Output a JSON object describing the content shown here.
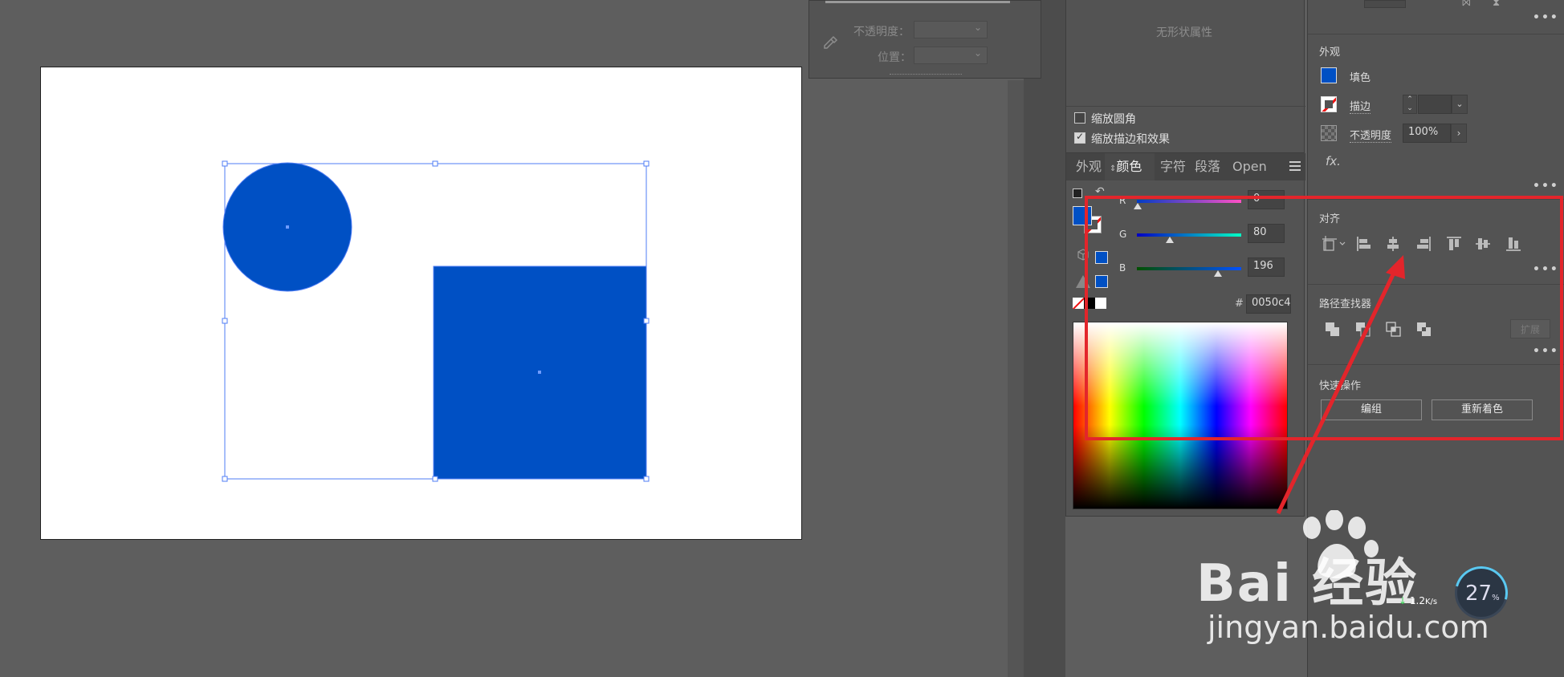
{
  "transparency_panel": {
    "opacity_label": "不透明度：",
    "position_label": "位置："
  },
  "transform_panel": {
    "no_shape_props": "无形状属性",
    "scale_corners": "缩放圆角",
    "scale_strokes": "缩放描边和效果"
  },
  "color_panel": {
    "tabs": [
      "外观",
      "颜色",
      "字符",
      "段落",
      "Open"
    ],
    "r_label": "R",
    "g_label": "G",
    "b_label": "B",
    "r_value": "0",
    "g_value": "80",
    "b_value": "196",
    "hash_label": "#",
    "hex_value": "0050c4",
    "fill_color": "#0050c4"
  },
  "properties_panel": {
    "appearance_title": "外观",
    "fill_label": "填色",
    "stroke_label": "描边",
    "opacity_label": "不透明度",
    "opacity_value": "100%",
    "fx_label": "fx.",
    "align_title": "对齐",
    "pathfinder_title": "路径查找器",
    "expand_label": "扩展",
    "quick_actions_title": "快速操作",
    "group_button": "编组",
    "recolor_button": "重新着色"
  },
  "watermark": {
    "logo_text": "Bai 经验",
    "url": "jingyan.baidu.com"
  },
  "network_widget": {
    "percent": "27",
    "percent_sign": "%",
    "speed": "1.2",
    "speed_unit": "K/s"
  },
  "icons": [
    "eyedropper-icon",
    "swap-icon",
    "default-colors-icon",
    "cube-icon",
    "warning-icon",
    "none-swatch-icon",
    "fx-icon",
    "panel-menu-icon",
    "align-left-icon",
    "align-hcenter-icon",
    "align-right-icon",
    "align-top-icon",
    "align-vcenter-icon",
    "align-bottom-icon",
    "unite-icon",
    "minus-front-icon",
    "intersect-icon",
    "exclude-icon"
  ]
}
